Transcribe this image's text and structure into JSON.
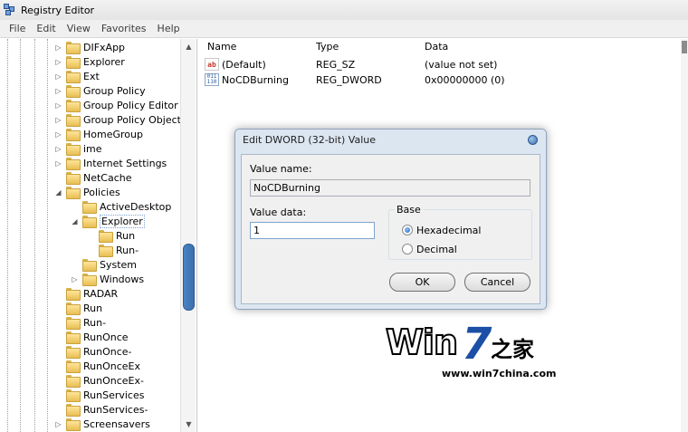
{
  "window": {
    "title": "Registry Editor"
  },
  "menu": [
    "File",
    "Edit",
    "View",
    "Favorites",
    "Help"
  ],
  "tree": {
    "items": [
      {
        "label": "DIFxApp",
        "expander": "closed",
        "level": 0
      },
      {
        "label": "Explorer",
        "expander": "closed",
        "level": 0
      },
      {
        "label": "Ext",
        "expander": "closed",
        "level": 0
      },
      {
        "label": "Group Policy",
        "expander": "closed",
        "level": 0
      },
      {
        "label": "Group Policy Editor",
        "expander": "closed",
        "level": 0
      },
      {
        "label": "Group Policy Objects",
        "expander": "closed",
        "level": 0
      },
      {
        "label": "HomeGroup",
        "expander": "closed",
        "level": 0
      },
      {
        "label": "ime",
        "expander": "closed",
        "level": 0
      },
      {
        "label": "Internet Settings",
        "expander": "closed",
        "level": 0
      },
      {
        "label": "NetCache",
        "expander": "none",
        "level": 0
      },
      {
        "label": "Policies",
        "expander": "open",
        "level": 0
      },
      {
        "label": "ActiveDesktop",
        "expander": "none",
        "level": 1
      },
      {
        "label": "Explorer",
        "expander": "open",
        "level": 1,
        "selected": true
      },
      {
        "label": "Run",
        "expander": "none",
        "level": 2
      },
      {
        "label": "Run-",
        "expander": "none",
        "level": 2
      },
      {
        "label": "System",
        "expander": "none",
        "level": 1
      },
      {
        "label": "Windows",
        "expander": "closed",
        "level": 1
      },
      {
        "label": "RADAR",
        "expander": "none",
        "level": 0
      },
      {
        "label": "Run",
        "expander": "none",
        "level": 0
      },
      {
        "label": "Run-",
        "expander": "none",
        "level": 0
      },
      {
        "label": "RunOnce",
        "expander": "none",
        "level": 0
      },
      {
        "label": "RunOnce-",
        "expander": "none",
        "level": 0
      },
      {
        "label": "RunOnceEx",
        "expander": "none",
        "level": 0
      },
      {
        "label": "RunOnceEx-",
        "expander": "none",
        "level": 0
      },
      {
        "label": "RunServices",
        "expander": "none",
        "level": 0
      },
      {
        "label": "RunServices-",
        "expander": "none",
        "level": 0
      },
      {
        "label": "Screensavers",
        "expander": "closed",
        "level": 0
      }
    ]
  },
  "values": {
    "headers": {
      "name": "Name",
      "type": "Type",
      "data": "Data"
    },
    "rows": [
      {
        "icon": "string-value-icon",
        "name": "(Default)",
        "type": "REG_SZ",
        "data": "(value not set)"
      },
      {
        "icon": "binary-value-icon",
        "name": "NoCDBurning",
        "type": "REG_DWORD",
        "data": "0x00000000 (0)"
      }
    ]
  },
  "dialog": {
    "title": "Edit DWORD (32-bit) Value",
    "value_name_label": "Value name:",
    "value_name": "NoCDBurning",
    "value_data_label": "Value data:",
    "value_data": "1",
    "base_label": "Base",
    "hex_label": "Hexadecimal",
    "dec_label": "Decimal",
    "base_selected": "Hexadecimal",
    "ok_label": "OK",
    "cancel_label": "Cancel"
  },
  "watermark": {
    "brand_a": "Win",
    "brand_b": "7",
    "brand_cn": "之家",
    "url": "www.win7china.com"
  }
}
